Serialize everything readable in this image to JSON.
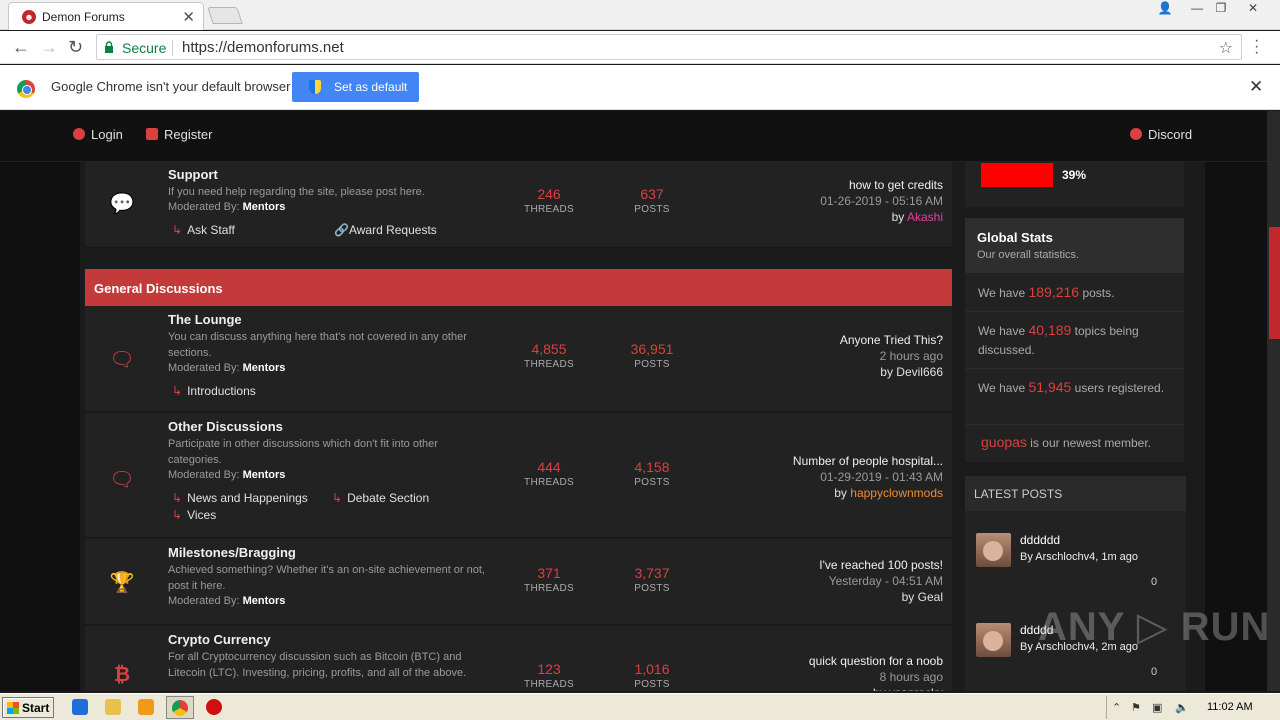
{
  "browser": {
    "tab_title": "Demon Forums",
    "tab_close": "✕",
    "url_secure": "Secure",
    "url": "https://demonforums.net",
    "infobar_message": "Google Chrome isn't your default browser",
    "set_default_label": "Set as default"
  },
  "header": {
    "login_label": "Login",
    "register_label": "Register",
    "discord_label": "Discord"
  },
  "forums": {
    "support": {
      "name": "Support",
      "desc": "If you need help regarding the site, please post here.",
      "mod_prefix": "Moderated By:",
      "mod": "Mentors",
      "subs": [
        "Ask Staff",
        "Award Requests"
      ],
      "threads": "246",
      "posts": "637",
      "last_title": "how to get credits",
      "last_time": "01-26-2019 - 05:16 AM",
      "last_by_prefix": "by",
      "last_user": "Akashi",
      "last_user_color": "#e040a0"
    },
    "category_title": "General Discussions",
    "lounge": {
      "name": "The Lounge",
      "desc": "You can discuss anything here that's not covered in any other sections.",
      "mod_prefix": "Moderated By:",
      "mod": "Mentors",
      "subs": [
        "Introductions"
      ],
      "threads": "4,855",
      "posts": "36,951",
      "last_title": "Anyone Tried This?",
      "last_time": "2 hours ago",
      "last_by_prefix": "by",
      "last_user": "Devil666",
      "last_user_color": "#e0e0e0"
    },
    "other": {
      "name": "Other Discussions",
      "desc": "Participate in other discussions which don't fit into other categories.",
      "mod_prefix": "Moderated By:",
      "mod": "Mentors",
      "subs": [
        "News and Happenings",
        "Debate Section",
        "Vices"
      ],
      "threads": "444",
      "posts": "4,158",
      "last_title": "Number of people hospital...",
      "last_time": "01-29-2019 - 01:43 AM",
      "last_by_prefix": "by",
      "last_user": "happyclownmods",
      "last_user_color": "#f08a30"
    },
    "milestones": {
      "name": "Milestones/Bragging",
      "desc": "Achieved something? Whether it's an on-site achievement or not, post it here.",
      "mod_prefix": "Moderated By:",
      "mod": "Mentors",
      "threads": "371",
      "posts": "3,737",
      "last_title": "I've reached 100 posts!",
      "last_time": "Yesterday - 04:51 AM",
      "last_by_prefix": "by",
      "last_user": "Geal",
      "last_user_color": "#e0e0e0"
    },
    "crypto": {
      "name": "Crypto Currency",
      "desc": "For all Cryptocurrency discussion such as Bitcoin (BTC) and Litecoin (LTC). Investing, pricing, profits, and all of the above.",
      "threads": "123",
      "posts": "1,016",
      "last_title": "quick question for a noob",
      "last_time": "8 hours ago",
      "last_by_prefix": "by",
      "last_user": "vsanrocky",
      "last_user_color": "#e0e0e0"
    },
    "threads_label": "THREADS",
    "posts_label": "POSTS"
  },
  "sidebar": {
    "progress_percent": 39,
    "progress_label": "39%",
    "global_title": "Global Stats",
    "global_subtitle": "Our overall statistics.",
    "we_have": "We have",
    "posts_count": "189,216",
    "posts_suffix": "posts.",
    "topics_count": "40,189",
    "topics_suffix": "topics being discussed.",
    "users_count": "51,945",
    "users_suffix": "users registered.",
    "newest_user": "guopas",
    "newest_suffix": "is our newest member.",
    "latest_title": "LATEST POSTS",
    "latest": [
      {
        "title": "dddddd",
        "by_prefix": "By",
        "user": "Arschlochv4",
        "ago": ", 1m ago",
        "replies": "0"
      },
      {
        "title": "ddddd",
        "by_prefix": "By",
        "user": "Arschlochv4",
        "ago": ", 2m ago",
        "replies": "0"
      }
    ]
  },
  "watermark": "ANY ▷ RUN",
  "taskbar": {
    "start_label": "Start",
    "clock": "11:02 AM"
  }
}
